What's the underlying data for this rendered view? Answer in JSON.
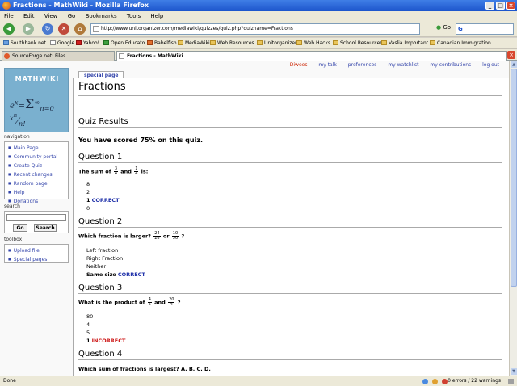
{
  "window": {
    "title": "Fractions - MathWiki - Mozilla Firefox"
  },
  "menu": [
    "File",
    "Edit",
    "View",
    "Go",
    "Bookmarks",
    "Tools",
    "Help"
  ],
  "navigation_bar": {
    "url": "http://www.unitorganizer.com/mediawiki/quizzes/quiz.php?quizname=Fractions",
    "go_label": "Go",
    "search_value": "G"
  },
  "bookmarks": [
    "Southbank.net",
    "Google",
    "Yahoo!",
    "Open Educato",
    "Babelfish",
    "MediaWiki",
    "Web Resources",
    "Unitorganizer",
    "Web Hacks",
    "School Resources",
    "Vaslia Important",
    "Canadian Immigration"
  ],
  "tabs": [
    {
      "label": "SourceForge.net: Files",
      "active": false
    },
    {
      "label": "Fractions - MathWiki",
      "active": true
    }
  ],
  "personal_links": {
    "user": "Diwees",
    "talk": "my talk",
    "preferences": "preferences",
    "watchlist": "my watchlist",
    "contributions": "my contributions",
    "logout": "log out"
  },
  "logo": {
    "text": "MATHWIKI",
    "formula": "e^x = Σ x^n / n!"
  },
  "sidebar": {
    "navigation_heading": "navigation",
    "navigation_items": [
      "Main Page",
      "Community portal",
      "Create Quiz",
      "Recent changes",
      "Random page",
      "Help",
      "Donations"
    ],
    "search_heading": "search",
    "search_go": "Go",
    "search_search": "Search",
    "toolbox_heading": "toolbox",
    "toolbox_items": [
      "Upload file",
      "Special pages"
    ]
  },
  "page_tab": "special page",
  "article": {
    "title": "Fractions",
    "results_heading": "Quiz Results",
    "score_text": "You have scored 75% on this quiz.",
    "questions": [
      {
        "heading": "Question 1",
        "prompt_pre": "The sum of",
        "f1": [
          "3",
          "4"
        ],
        "mid": "and",
        "f2": [
          "1",
          "4"
        ],
        "post": "is:",
        "answers": [
          "8",
          "2",
          "1",
          "0"
        ],
        "selected": 2,
        "mark": "CORRECT"
      },
      {
        "heading": "Question 2",
        "prompt_pre": "Which fraction is larger?",
        "f1": [
          "24",
          "28"
        ],
        "mid": "or",
        "f2": [
          "10",
          "50"
        ],
        "post": "?",
        "answers": [
          "Left fraction",
          "Right Fraction",
          "Neither",
          "Same size"
        ],
        "selected": 3,
        "mark": "CORRECT"
      },
      {
        "heading": "Question 3",
        "prompt_pre": "What is the product of",
        "f1": [
          "4",
          "5"
        ],
        "mid": "and",
        "f2": [
          "20",
          "4"
        ],
        "post": "?",
        "answers": [
          "80",
          "4",
          "5",
          "1"
        ],
        "selected": 3,
        "mark": "INCORRECT"
      },
      {
        "heading": "Question 4",
        "prompt_pre": "Which sum of fractions is largest?",
        "options_text": "A.   B.   C.   D."
      }
    ]
  },
  "status": {
    "left": "Done",
    "right": "0 errors / 22 warnings"
  }
}
